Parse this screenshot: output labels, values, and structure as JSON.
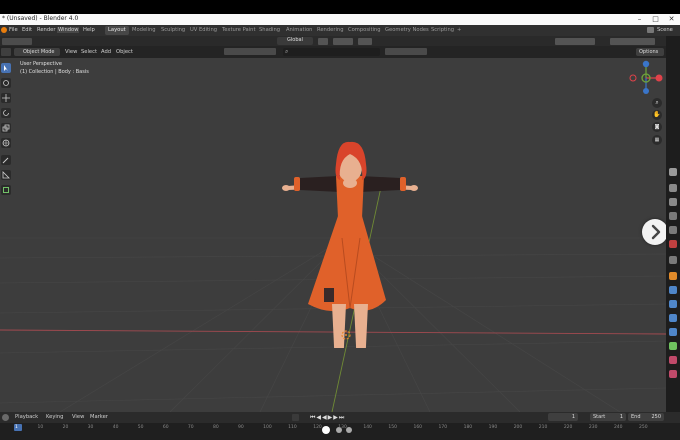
{
  "window": {
    "title": "* (Unsaved) - Blender 4.0"
  },
  "menu": [
    "File",
    "Edit",
    "Render",
    "Window",
    "Help"
  ],
  "workspaces": [
    {
      "label": "Layout",
      "active": true
    },
    {
      "label": "Modeling"
    },
    {
      "label": "Sculpting"
    },
    {
      "label": "UV Editing"
    },
    {
      "label": "Texture Paint"
    },
    {
      "label": "Shading"
    },
    {
      "label": "Animation"
    },
    {
      "label": "Rendering"
    },
    {
      "label": "Compositing"
    },
    {
      "label": "Geometry Nodes"
    },
    {
      "label": "Scripting"
    }
  ],
  "add_workspace": "+",
  "scene_label": "Scene",
  "header": {
    "mode": "Object Mode",
    "view_menus": [
      "View",
      "Select",
      "Add",
      "Object"
    ],
    "transform_orientation": "Global",
    "options": "Options"
  },
  "viewport": {
    "perspective": "User Perspective",
    "collection": "(1) Collection | Body : Basis"
  },
  "gizmo": {
    "x": "X",
    "y": "Y",
    "z": "Z"
  },
  "colors": {
    "accent": "#4772b3",
    "axis_x": "#e0424a",
    "axis_y": "#6fa53a",
    "axis_z": "#3a75c9",
    "character_dress": "#e0612a",
    "character_skin": "#e8b090",
    "character_hair": "#d9442b"
  },
  "timeline": {
    "menus": [
      "Playback",
      "Keying",
      "View",
      "Marker"
    ],
    "start_label": "Start",
    "start_value": "1",
    "end_label": "End",
    "end_value": "250",
    "current_frame": "1",
    "ticks": [
      "1",
      "10",
      "20",
      "30",
      "40",
      "50",
      "60",
      "70",
      "80",
      "90",
      "100",
      "110",
      "120",
      "130",
      "140",
      "150",
      "160",
      "170",
      "180",
      "190",
      "200",
      "210",
      "220",
      "230",
      "240",
      "250"
    ]
  },
  "overlay": {
    "next_icon": "chevron-right-icon",
    "carousel_dots": 3
  }
}
